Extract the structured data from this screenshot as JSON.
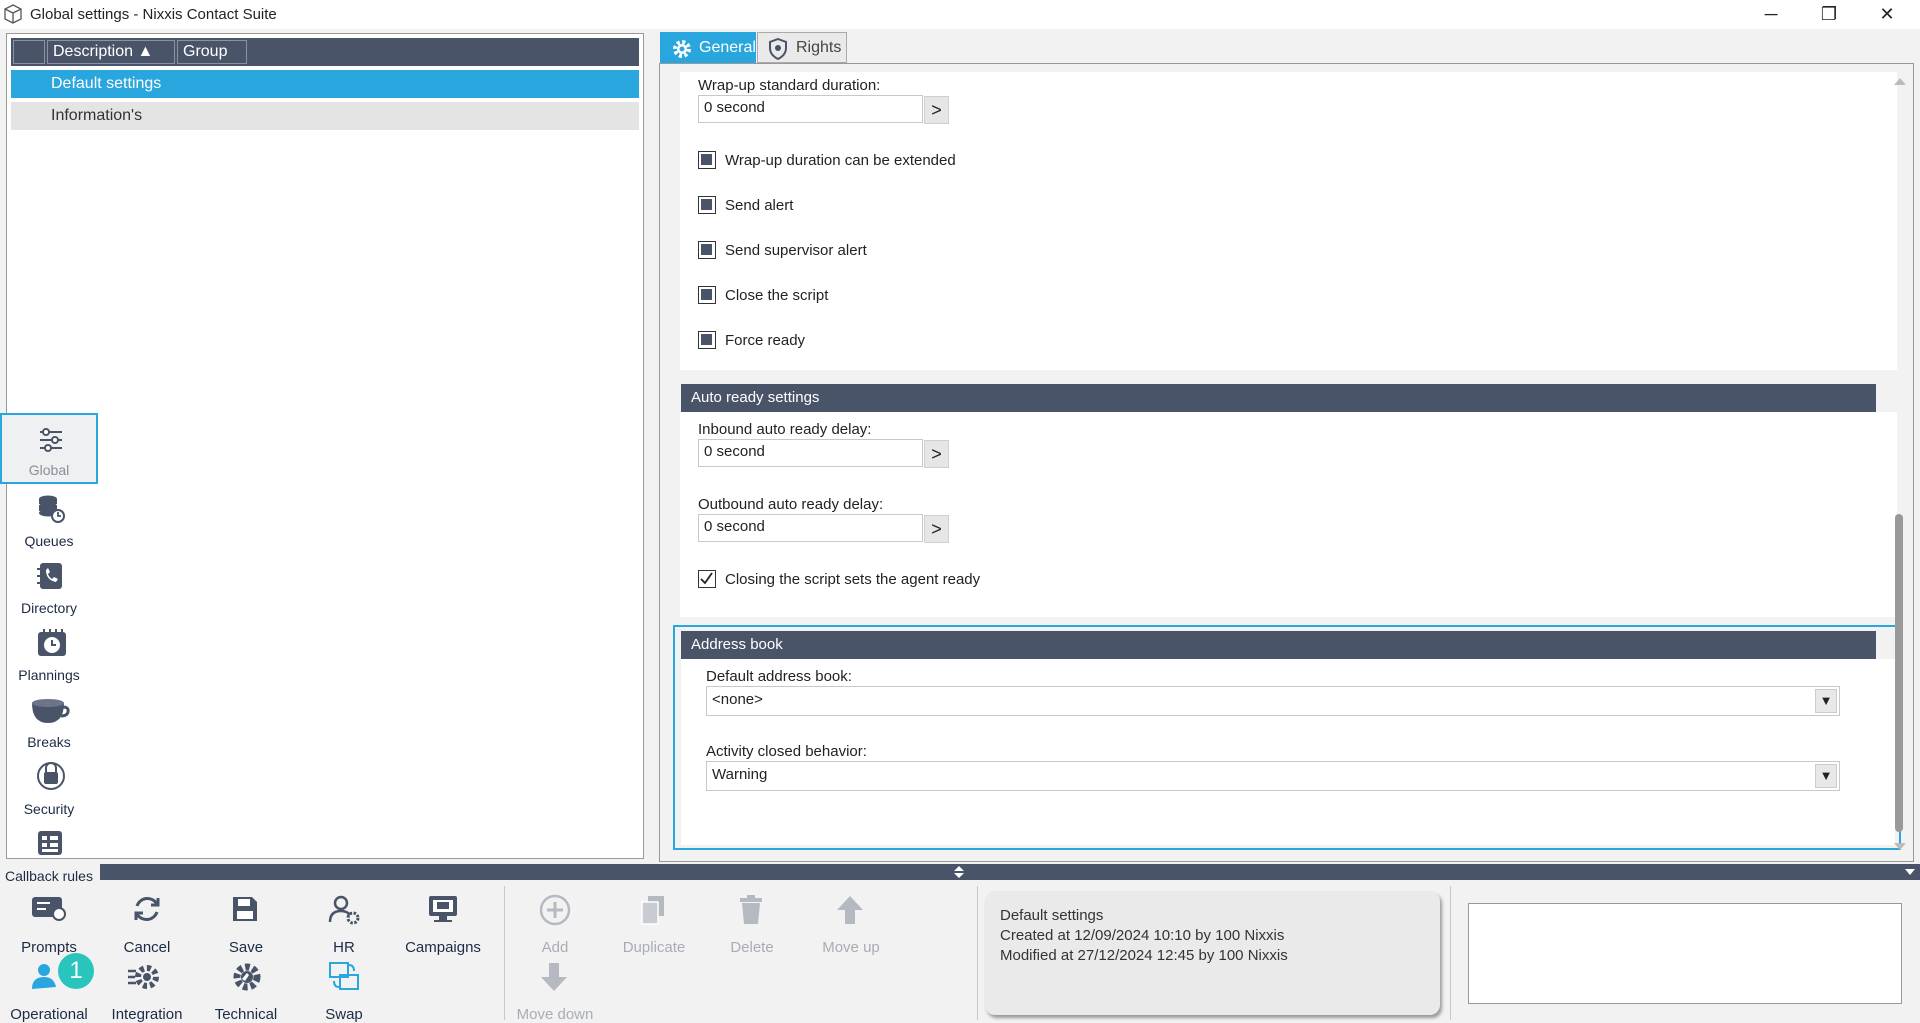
{
  "window": {
    "title": "Global settings - Nixxis Contact Suite",
    "minimize": "─",
    "maximize": "❐",
    "close": "✕"
  },
  "list": {
    "columns": [
      "",
      "Description ▲",
      "Group"
    ],
    "rows": [
      "Default settings",
      "Information's"
    ]
  },
  "nav": {
    "items": [
      {
        "label": "Global",
        "icon": "sliders-icon"
      },
      {
        "label": "Queues",
        "icon": "queues-icon"
      },
      {
        "label": "Directory",
        "icon": "directory-phone-icon"
      },
      {
        "label": "Plannings",
        "icon": "calendar-clock-icon"
      },
      {
        "label": "Breaks",
        "icon": "cup-icon"
      },
      {
        "label": "Security",
        "icon": "security-lock-icon"
      },
      {
        "label": "Callback rules",
        "icon": "callback-rules-icon"
      }
    ]
  },
  "tabs": {
    "general": "General",
    "rights": "Rights"
  },
  "wrapup": {
    "standard_duration_label": "Wrap-up standard duration:",
    "standard_duration_value": "0 second",
    "arrow": ">",
    "checks": [
      {
        "label": "Wrap-up duration can be extended",
        "state": "indeterminate"
      },
      {
        "label": "Send alert",
        "state": "indeterminate"
      },
      {
        "label": "Send supervisor alert",
        "state": "indeterminate"
      },
      {
        "label": "Close the script",
        "state": "indeterminate"
      },
      {
        "label": "Force ready",
        "state": "indeterminate"
      }
    ]
  },
  "auto_ready": {
    "title": "Auto ready settings",
    "inbound_label": "Inbound auto ready delay:",
    "inbound_value": "0 second",
    "outbound_label": "Outbound auto ready delay:",
    "outbound_value": "0 second",
    "closing_check": {
      "label": "Closing the script sets the agent ready",
      "state": "checked"
    }
  },
  "address_book": {
    "title": "Address book",
    "default_label": "Default address book:",
    "default_value": "<none>",
    "activity_label": "Activity closed behavior:",
    "activity_value": "Warning"
  },
  "toolbar": {
    "row1": [
      {
        "label": "Prompts",
        "icon": "prompts-icon"
      },
      {
        "label": "Cancel",
        "icon": "refresh-icon"
      },
      {
        "label": "Save",
        "icon": "save-icon"
      },
      {
        "label": "HR",
        "icon": "hr-icon"
      },
      {
        "label": "Campaigns",
        "icon": "campaigns-icon"
      }
    ],
    "row2": [
      {
        "label": "Operational",
        "icon": "operational-icon"
      },
      {
        "label": "Integration",
        "icon": "integration-gear-icon"
      },
      {
        "label": "Technical",
        "icon": "technical-gear-icon"
      },
      {
        "label": "Swap",
        "icon": "swap-icon"
      }
    ],
    "edit": [
      {
        "label": "Add",
        "icon": "add-icon"
      },
      {
        "label": "Duplicate",
        "icon": "duplicate-icon"
      },
      {
        "label": "Delete",
        "icon": "trash-icon"
      },
      {
        "label": "Move up",
        "icon": "arrow-up-icon"
      },
      {
        "label": "Move down",
        "icon": "arrow-down-icon"
      }
    ],
    "badge": "1"
  },
  "info": {
    "name": "Default settings",
    "created": "Created at 12/09/2024 10:10 by 100 Nixxis",
    "modified": "Modified at 27/12/2024 12:45 by 100 Nixxis"
  },
  "colors": {
    "accent": "#29a6de",
    "header": "#4a5468",
    "badge": "#29c4bb"
  }
}
